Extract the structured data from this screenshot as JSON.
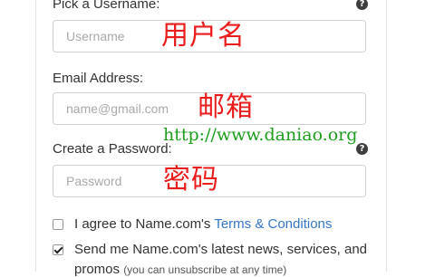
{
  "username": {
    "label": "Pick a Username:",
    "placeholder": "Username",
    "help_icon": "question-circle-icon",
    "annotation": "用户名"
  },
  "email": {
    "label": "Email Address:",
    "placeholder": "name@gmail.com",
    "annotation": "邮箱"
  },
  "watermark": "http://www.daniao.org",
  "password": {
    "label": "Create a Password:",
    "placeholder": "Password",
    "help_icon": "question-circle-icon",
    "annotation": "密码"
  },
  "terms": {
    "checked": false,
    "text": "I agree to Name.com's ",
    "link": "Terms & Conditions"
  },
  "newsletter": {
    "checked": true,
    "text_line1": "Send me Name.com's latest news, services, and",
    "text_line2": "promos ",
    "note": "(you can unsubscribe at any time)"
  },
  "colors": {
    "annotation_red": "#ea1c1c",
    "watermark_green": "#1f9d1f",
    "link_blue": "#3577c4"
  }
}
